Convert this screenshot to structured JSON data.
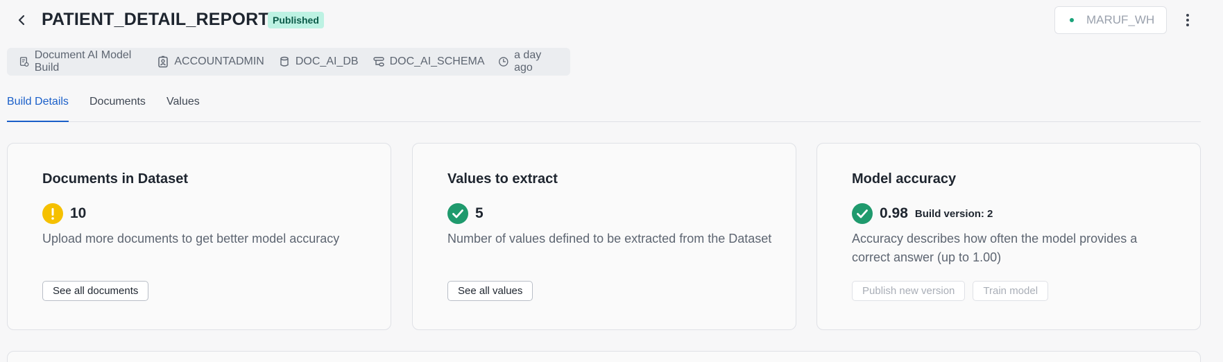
{
  "header": {
    "title": "PATIENT_DETAIL_REPORT",
    "status_badge": "Published",
    "warehouse": "MARUF_WH",
    "status_color": "#1aa37a"
  },
  "meta": {
    "items": [
      {
        "icon": "document-model-icon",
        "label": "Document AI Model Build"
      },
      {
        "icon": "role-badge-icon",
        "label": "ACCOUNTADMIN"
      },
      {
        "icon": "database-icon",
        "label": "DOC_AI_DB"
      },
      {
        "icon": "schema-icon",
        "label": "DOC_AI_SCHEMA"
      },
      {
        "icon": "clock-icon",
        "label": "a day ago"
      }
    ]
  },
  "tabs": [
    {
      "label": "Build Details",
      "active": true
    },
    {
      "label": "Documents",
      "active": false
    },
    {
      "label": "Values",
      "active": false
    }
  ],
  "cards": {
    "documents": {
      "title": "Documents in Dataset",
      "status_icon": "warning-icon",
      "status_color": "#f5c000",
      "value": "10",
      "description": "Upload more documents to get better model accuracy",
      "button": "See all documents"
    },
    "values": {
      "title": "Values to extract",
      "status_icon": "check-icon",
      "status_color": "#1f9a6d",
      "value": "5",
      "description": "Number of values defined to be extracted from the Dataset",
      "button": "See all values"
    },
    "accuracy": {
      "title": "Model accuracy",
      "status_icon": "check-icon",
      "status_color": "#1f9a6d",
      "value": "0.98",
      "sub": "Build version: 2",
      "description": "Accuracy describes how often the model provides a correct answer (up to 1.00)",
      "button_publish": "Publish new version",
      "button_train": "Train model"
    }
  },
  "colors": {
    "accent": "#1a5fc9",
    "badge_bg": "#bdf2e3"
  }
}
